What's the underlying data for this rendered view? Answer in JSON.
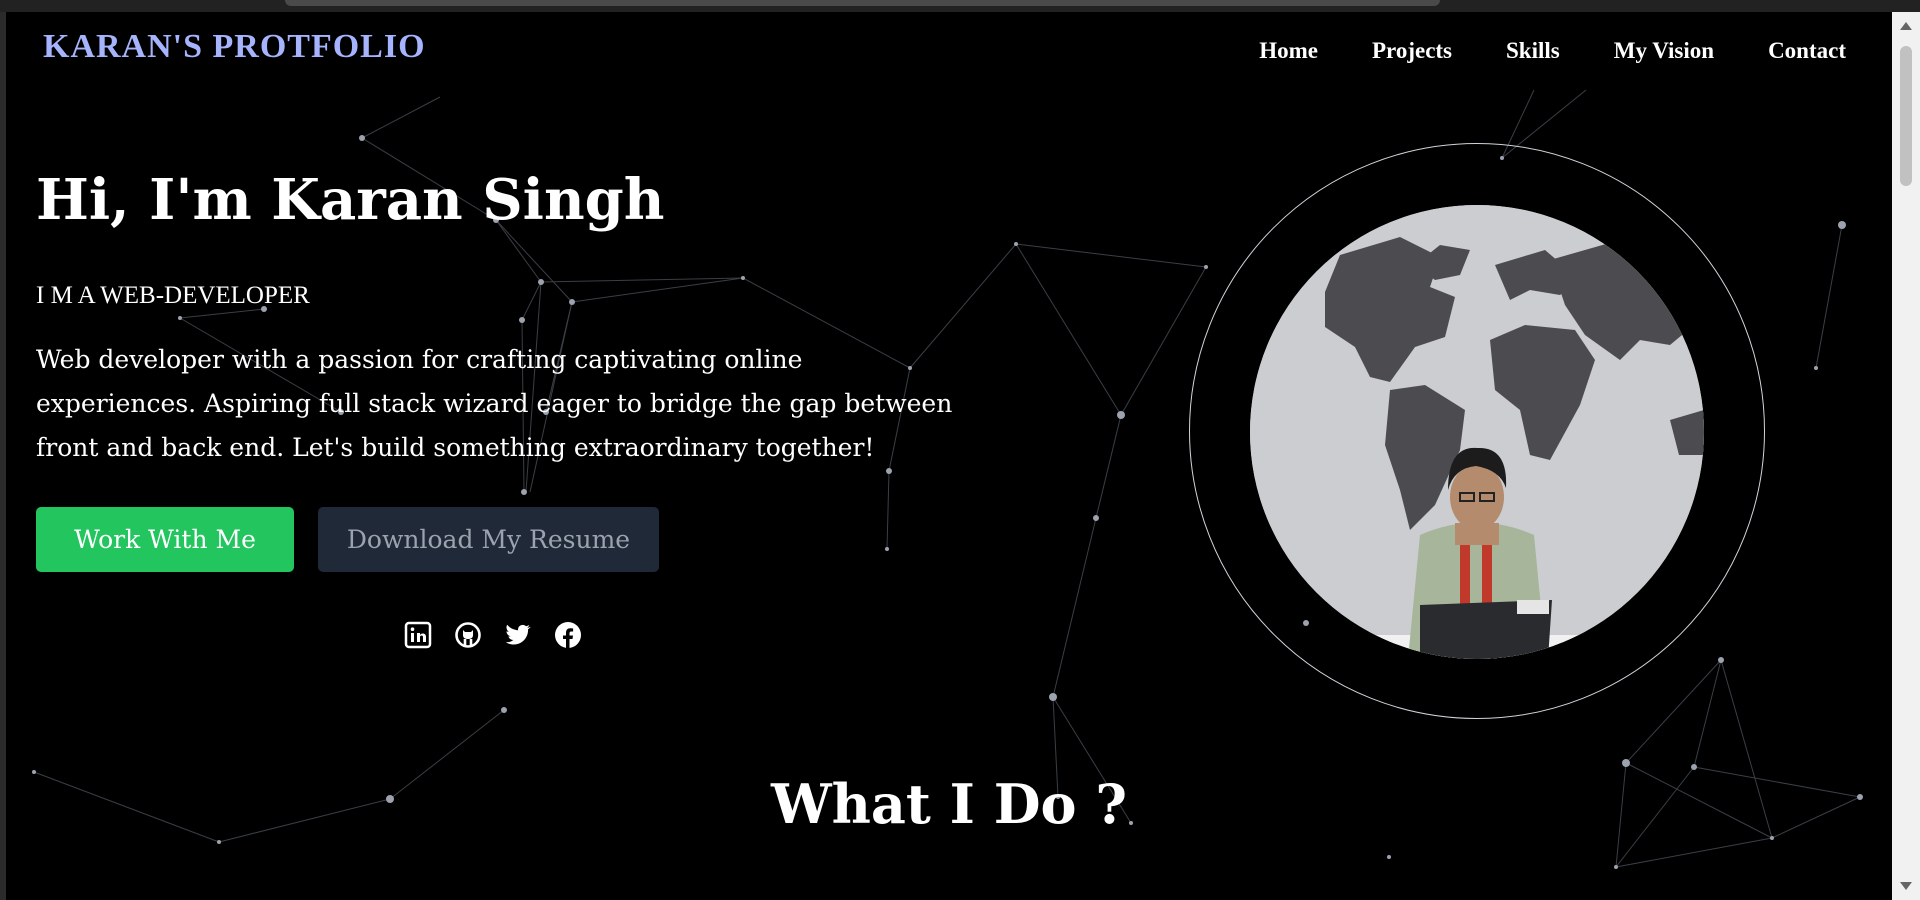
{
  "header": {
    "brand": "KARAN'S PROTFOLIO",
    "nav": [
      "Home",
      "Projects",
      "Skills",
      "My Vision",
      "Contact"
    ]
  },
  "hero": {
    "title": "Hi, I'm Karan Singh",
    "subtitle": "I M A WEB-DEVELOPER",
    "description": "Web developer with a passion for crafting captivating online experiences. Aspiring full stack wizard eager to bridge the gap between front and back end. Let's build something extraordinary together!",
    "primary_button": "Work With Me",
    "secondary_button": "Download My Resume",
    "socials": [
      "linkedin-icon",
      "github-icon",
      "twitter-icon",
      "facebook-icon"
    ]
  },
  "section": {
    "title": "What I Do ?"
  },
  "colors": {
    "brand": "#a5b4fc",
    "primary": "#22c55e",
    "secondary_bg": "#1f2937",
    "secondary_text": "#9ca3af",
    "background": "#000000"
  }
}
